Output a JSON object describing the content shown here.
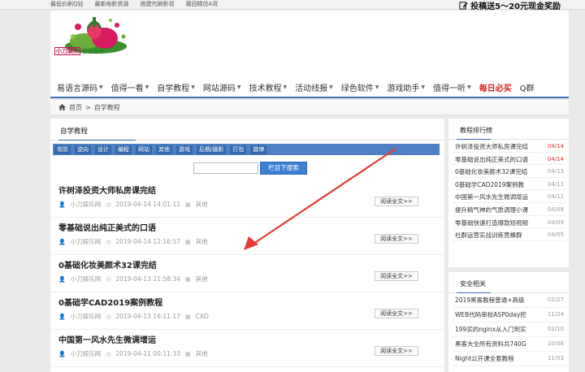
{
  "topbar": {
    "links": [
      "最低价刷Q钻",
      "最新电影资源",
      "搭建代刷影视",
      "莆田精仿A货"
    ],
    "promo": "投稿送5～20元现金奖励"
  },
  "logo": {
    "text_left": "小刀娱乐",
    "text_right": "乐于分享"
  },
  "nav": {
    "items": [
      {
        "label": "易语言源码",
        "caret": true
      },
      {
        "label": "值得一看",
        "caret": true
      },
      {
        "label": "自学教程",
        "caret": true
      },
      {
        "label": "网站源码",
        "caret": true
      },
      {
        "label": "技术教程",
        "caret": true
      },
      {
        "label": "活动线报",
        "caret": true
      },
      {
        "label": "绿色软件",
        "caret": true
      },
      {
        "label": "游戏助手",
        "caret": true
      },
      {
        "label": "值得一听",
        "caret": true
      },
      {
        "label": "每日必买",
        "caret": false
      },
      {
        "label": "Q群",
        "caret": false
      }
    ]
  },
  "breadcrumb": {
    "home": "首页",
    "sep": ">",
    "current": "自学教程"
  },
  "main": {
    "title": "自学教程",
    "categories": [
      "攻防",
      "逆向",
      "设计",
      "编程",
      "网站",
      "其他",
      "游戏",
      "后期/摄影",
      "打包",
      "旋律"
    ],
    "search_button": "栏目下搜索",
    "read_more": "阅读全文>>",
    "posts": [
      {
        "title": "许树泽投资大师私房课完结",
        "author": "小刀娱乐网",
        "date": "2019-04-14 14:01:11",
        "category": "其他"
      },
      {
        "title": "零基础说出纯正美式的口语",
        "author": "小刀娱乐网",
        "date": "2019-04-14 12:16:57",
        "category": "其他"
      },
      {
        "title": "0基础化妆美颜术32课完结",
        "author": "小刀娱乐网",
        "date": "2019-04-13 21:58:34",
        "category": "其他"
      },
      {
        "title": "0基础学CAD2019案例教程",
        "author": "小刀娱乐网",
        "date": "2019-04-13 16:11:17",
        "category": "CAD"
      },
      {
        "title": "中国第一风水先生微调增运",
        "author": "小刀娱乐网",
        "date": "2019-04-11 00:11:33",
        "category": "其他"
      }
    ]
  },
  "sidebar": {
    "rank_title": "教程排行榜",
    "rank": [
      {
        "title": "许树泽投资大师私房课完结",
        "date": "04/14",
        "recent": true
      },
      {
        "title": "零基础说出纯正美式的口语",
        "date": "04/14",
        "recent": true
      },
      {
        "title": "0基础化妆美颜术32课完结",
        "date": "04/13",
        "recent": false
      },
      {
        "title": "0基础学CAD2019案例教",
        "date": "04/13",
        "recent": false
      },
      {
        "title": "中国第一风水先生微调增运",
        "date": "04/11",
        "recent": false
      },
      {
        "title": "提升精气神的气质调理小课",
        "date": "04/09",
        "recent": false
      },
      {
        "title": "零基础快速打造爆款短视频",
        "date": "04/09",
        "recent": false
      },
      {
        "title": "社群运营实战训练营蜂群",
        "date": "04/05",
        "recent": false
      }
    ],
    "security_title": "安全相关",
    "security": [
      {
        "title": "2019黑客教程普通+高级",
        "date": "02/27"
      },
      {
        "title": "WEB代码审校ASP0day挖",
        "date": "11/24"
      },
      {
        "title": "199买的nginx从入门到实",
        "date": "02/10"
      },
      {
        "title": "黑客大全所有资料共740G",
        "date": "10/08"
      },
      {
        "title": "Night公开课全套教程",
        "date": "11/03"
      }
    ]
  },
  "colors": {
    "accent": "#3b6cb4",
    "hot": "#e02020",
    "arrow": "#e53935"
  }
}
